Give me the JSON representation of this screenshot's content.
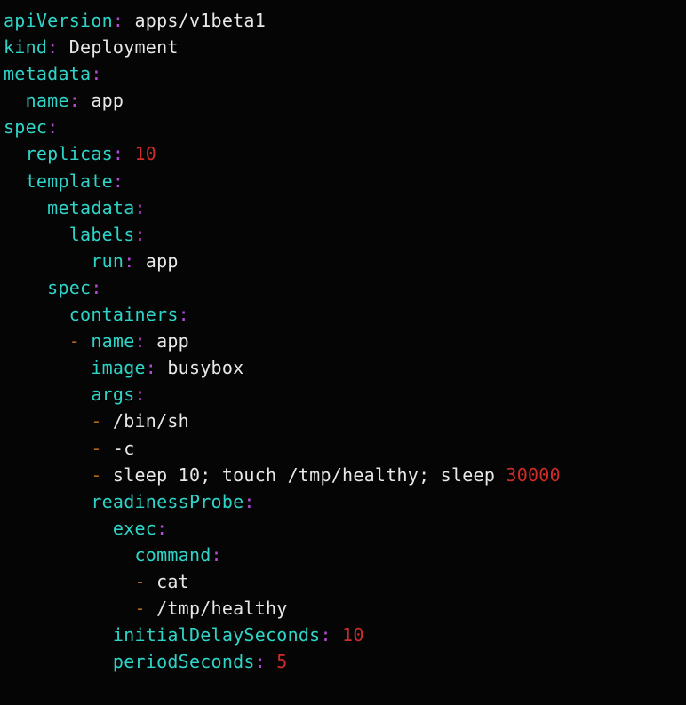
{
  "editor": {
    "language": "yaml",
    "background_color": "#050505",
    "colors": {
      "key": "#2fd4c8",
      "punctuation": "#b44ad6",
      "value": "#e8e8e8",
      "number": "#cf2b2b",
      "list_dash": "#b5651d"
    }
  },
  "document": {
    "lines": [
      {
        "indent": "",
        "dash": "",
        "key": "apiVersion",
        "colon": ":",
        "value": " apps/v1beta1",
        "value_type": "string"
      },
      {
        "indent": "",
        "dash": "",
        "key": "kind",
        "colon": ":",
        "value": " Deployment",
        "value_type": "string"
      },
      {
        "indent": "",
        "dash": "",
        "key": "metadata",
        "colon": ":",
        "value": "",
        "value_type": "none"
      },
      {
        "indent": "  ",
        "dash": "",
        "key": "name",
        "colon": ":",
        "value": " app",
        "value_type": "string"
      },
      {
        "indent": "",
        "dash": "",
        "key": "spec",
        "colon": ":",
        "value": "",
        "value_type": "none"
      },
      {
        "indent": "  ",
        "dash": "",
        "key": "replicas",
        "colon": ":",
        "value": " 10",
        "value_type": "number"
      },
      {
        "indent": "  ",
        "dash": "",
        "key": "template",
        "colon": ":",
        "value": "",
        "value_type": "none"
      },
      {
        "indent": "    ",
        "dash": "",
        "key": "metadata",
        "colon": ":",
        "value": "",
        "value_type": "none"
      },
      {
        "indent": "      ",
        "dash": "",
        "key": "labels",
        "colon": ":",
        "value": "",
        "value_type": "none"
      },
      {
        "indent": "        ",
        "dash": "",
        "key": "run",
        "colon": ":",
        "value": " app",
        "value_type": "string"
      },
      {
        "indent": "    ",
        "dash": "",
        "key": "spec",
        "colon": ":",
        "value": "",
        "value_type": "none"
      },
      {
        "indent": "      ",
        "dash": "",
        "key": "containers",
        "colon": ":",
        "value": "",
        "value_type": "none"
      },
      {
        "indent": "      ",
        "dash": "- ",
        "key": "name",
        "colon": ":",
        "value": " app",
        "value_type": "string"
      },
      {
        "indent": "        ",
        "dash": "",
        "key": "image",
        "colon": ":",
        "value": " busybox",
        "value_type": "string"
      },
      {
        "indent": "        ",
        "dash": "",
        "key": "args",
        "colon": ":",
        "value": "",
        "value_type": "none"
      },
      {
        "indent": "        ",
        "dash": "- ",
        "key": "",
        "colon": "",
        "value": "/bin/sh",
        "value_type": "item"
      },
      {
        "indent": "        ",
        "dash": "- ",
        "key": "",
        "colon": "",
        "value": "-c",
        "value_type": "item"
      },
      {
        "indent": "        ",
        "dash": "- ",
        "key": "",
        "colon": "",
        "value": "sleep 10; touch /tmp/healthy; sleep ",
        "trailing_number": "30000",
        "value_type": "item_with_number"
      },
      {
        "indent": "        ",
        "dash": "",
        "key": "readinessProbe",
        "colon": ":",
        "value": "",
        "value_type": "none"
      },
      {
        "indent": "          ",
        "dash": "",
        "key": "exec",
        "colon": ":",
        "value": "",
        "value_type": "none"
      },
      {
        "indent": "            ",
        "dash": "",
        "key": "command",
        "colon": ":",
        "value": "",
        "value_type": "none"
      },
      {
        "indent": "            ",
        "dash": "- ",
        "key": "",
        "colon": "",
        "value": "cat",
        "value_type": "item"
      },
      {
        "indent": "            ",
        "dash": "- ",
        "key": "",
        "colon": "",
        "value": "/tmp/healthy",
        "value_type": "item"
      },
      {
        "indent": "          ",
        "dash": "",
        "key": "initialDelaySeconds",
        "colon": ":",
        "value": " 10",
        "value_type": "number"
      },
      {
        "indent": "          ",
        "dash": "",
        "key": "periodSeconds",
        "colon": ":",
        "value": " 5",
        "value_type": "number"
      }
    ]
  }
}
